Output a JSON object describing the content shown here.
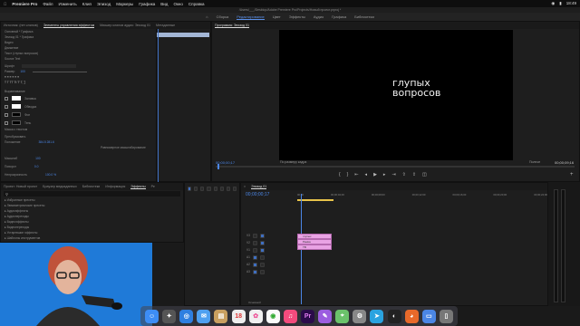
{
  "menubar": {
    "app_name": "Premiere Pro",
    "items": [
      "Файл",
      "Изменить",
      "Клип",
      "Эпизод",
      "Маркеры",
      "Графика",
      "Вид",
      "Окно",
      "Справка"
    ],
    "clock": "18:49"
  },
  "title_strip": "/Users/___/Desktop/Adobe Premiere Pro/Projects/Новый проект.prproj *",
  "workspaces": [
    "Сборка",
    "Редактирование",
    "Цвет",
    "Эффекты",
    "Аудио",
    "Графика",
    "Библиотеки"
  ],
  "workspace_active": "Редактирование",
  "top_left": {
    "tabs": [
      "Источник: (нет клипов)",
      "Элементы управления эффектом",
      "Микшер клипов аудио: Эпизод 01",
      "Метаданные"
    ],
    "active_tab": "Элементы управления эффектом",
    "rows": [
      {
        "label": "Основной * Графика",
        "value": ""
      },
      {
        "label": "Эпизод 01 * Графика",
        "value": ""
      },
      {
        "label": "Видео",
        "value": ""
      },
      {
        "label": "Движение",
        "value": ""
      },
      {
        "label": "Текст (глупых вопросов)",
        "value": ""
      },
      {
        "label": "Source Text",
        "value": ""
      },
      {
        "label": "Шрифт",
        "value": ""
      },
      {
        "label": "Размер",
        "value": "100"
      },
      {
        "label": "Выравнивание",
        "value": ""
      },
      {
        "label": "Заливка",
        "value": ""
      },
      {
        "label": "Обводка",
        "value": ""
      },
      {
        "label": "Фон",
        "value": ""
      },
      {
        "label": "Тень",
        "value": ""
      },
      {
        "label": "Маска с текстом",
        "value": ""
      },
      {
        "label": "Преобразовать",
        "value": ""
      },
      {
        "label": "Положение",
        "value": "384.5   281.6"
      },
      {
        "label": "Равномерное масштабирование",
        "value": ""
      },
      {
        "label": "Масштаб",
        "value": "100"
      },
      {
        "label": "Поворот",
        "value": "0.0"
      },
      {
        "label": "Непрозрачность",
        "value": "100.0 %"
      }
    ],
    "sub_labels": [
      "Привязать к кадру",
      "Масштаб",
      "Фон",
      "Тень"
    ]
  },
  "program_monitor": {
    "tab": "Программа: Эпизод 01",
    "overlay_text_line1": "глупых",
    "overlay_text_line2": "вопросов",
    "timecode_left": "00;00;00;17",
    "fit_label": "По размеру кадра",
    "quality": "Полное",
    "timecode_right": "00;00;09;16"
  },
  "project_panel": {
    "tabs": [
      "Проект: Новый проект",
      "Браузер медиаданных",
      "Библиотеки",
      "Информация",
      "Эффекты",
      "Ре"
    ],
    "active_tab": "Эффекты",
    "search_placeholder": "",
    "items": [
      "Избранные пресеты",
      "Люмиметрические пресеты",
      "Аудиоэффекты",
      "Аудиопереходы",
      "Видеоэффекты",
      "Видеопереходы",
      "Устаревшие эффекты",
      "Шаблоны инструментов"
    ]
  },
  "timeline": {
    "tab": "Эпизод 01",
    "timecode": "00;00;00;17",
    "ruler_ticks": [
      "00;00",
      "00;00;04;00",
      "00;00;08;00",
      "00;00;12;00",
      "00;00;16;00",
      "00;00;20;00",
      "00;00;24;00",
      "00;00;28;00"
    ],
    "tracks": [
      "V3",
      "V2",
      "V1",
      "A1",
      "A2",
      "A3"
    ],
    "clips": [
      "глупых",
      "Рамка",
      "ТВ"
    ],
    "master_label": "Основной"
  },
  "dock_icons": [
    "finder-icon",
    "launchpad-icon",
    "safari-icon",
    "mail-icon",
    "notes-icon",
    "calendar-icon",
    "photos-icon",
    "chrome-icon",
    "music-icon",
    "premiere-icon",
    "pen-icon",
    "maps-icon",
    "settings-icon",
    "telegram-icon",
    "obs-icon",
    "firefox-icon",
    "files-icon",
    "trash-icon"
  ],
  "colors": {
    "accent": "#4b86e6",
    "clip": "#e9a3e4",
    "webcam_bg": "#1f7ad8"
  }
}
